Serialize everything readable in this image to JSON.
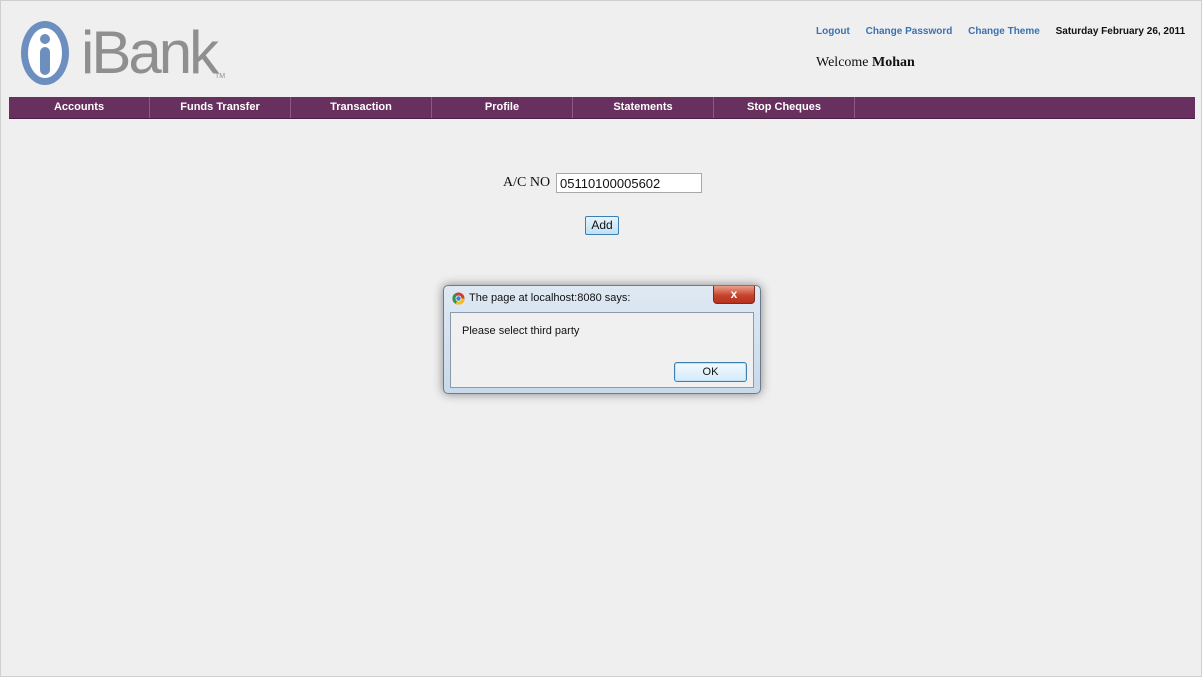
{
  "logo": {
    "text": "iBank",
    "tm": "TM"
  },
  "header": {
    "links": [
      "Logout",
      "Change Password",
      "Change Theme"
    ],
    "date": "Saturday February 26, 2011",
    "welcome_prefix": "Welcome",
    "user_name": "Mohan"
  },
  "nav": {
    "items": [
      "Accounts",
      "Funds Transfer",
      "Transaction",
      "Profile",
      "Statements",
      "Stop Cheques"
    ]
  },
  "form": {
    "acno_label": "A/C NO",
    "acno_value": "05110100005602",
    "add_label": "Add"
  },
  "dialog": {
    "title": "The page at localhost:8080 says:",
    "message": "Please select third party",
    "ok_label": "OK",
    "close_glyph": "x"
  },
  "colors": {
    "nav_bg": "#67305f",
    "link": "#3a72b0",
    "logo_blue": "#6d8fbf",
    "logo_gray": "#8f8f8f"
  }
}
